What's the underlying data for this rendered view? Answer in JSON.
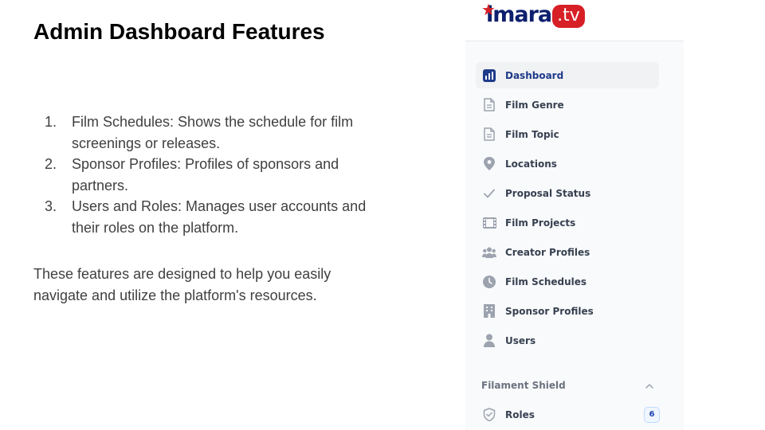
{
  "slide": {
    "title": "Admin Dashboard Features",
    "features": [
      {
        "num": "1.",
        "text": "Film Schedules: Shows the schedule for film screenings or releases."
      },
      {
        "num": "2.",
        "text": "Sponsor Profiles: Profiles of sponsors and partners."
      },
      {
        "num": "3.",
        "text": "Users and Roles: Manages user accounts and their roles on the platform."
      }
    ],
    "summary": "These features are designed to help you easily navigate and utilize the platform's resources."
  },
  "brand": {
    "logo_main": "imara",
    "logo_suffix": ".tv",
    "colors": {
      "navy": "#0d1f6e",
      "red": "#d71f26"
    }
  },
  "sidebar": {
    "items": [
      {
        "label": "Dashboard",
        "icon": "chart-bar-icon",
        "active": true
      },
      {
        "label": "Film Genre",
        "icon": "document-icon"
      },
      {
        "label": "Film Topic",
        "icon": "document-icon"
      },
      {
        "label": "Locations",
        "icon": "map-pin-icon"
      },
      {
        "label": "Proposal Status",
        "icon": "check-icon"
      },
      {
        "label": "Film Projects",
        "icon": "film-icon"
      },
      {
        "label": "Creator Profiles",
        "icon": "user-group-icon"
      },
      {
        "label": "Film Schedules",
        "icon": "clock-icon"
      },
      {
        "label": "Sponsor Profiles",
        "icon": "building-icon"
      },
      {
        "label": "Users",
        "icon": "user-icon"
      }
    ],
    "group": {
      "label": "Filament Shield",
      "icon": "chevron-up-icon"
    },
    "roles": {
      "label": "Roles",
      "icon": "shield-check-icon",
      "badge": "6"
    },
    "colors": {
      "active_text": "#1e3a8a",
      "icon_gray": "#9ca3af"
    }
  }
}
